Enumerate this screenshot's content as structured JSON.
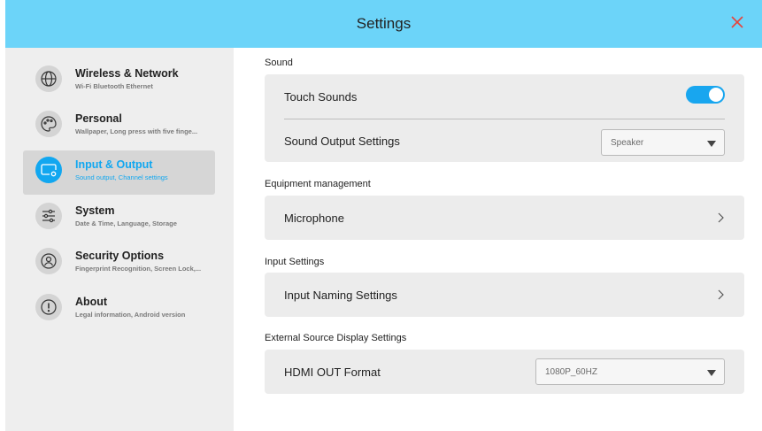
{
  "window": {
    "title": "Settings"
  },
  "sidebar": {
    "items": [
      {
        "label": "Wireless & Network",
        "subtitle": "Wi-Fi Bluetooth Ethernet",
        "icon": "globe-icon"
      },
      {
        "label": "Personal",
        "subtitle": "Wallpaper, Long press with five finge...",
        "icon": "palette-icon"
      },
      {
        "label": "Input & Output",
        "subtitle": "Sound output, Channel settings",
        "icon": "monitor-gear-icon",
        "active": true
      },
      {
        "label": "System",
        "subtitle": "Date & Time, Language, Storage",
        "icon": "sliders-icon"
      },
      {
        "label": "Security Options",
        "subtitle": "Fingerprint Recognition, Screen Lock,...",
        "icon": "user-shield-icon"
      },
      {
        "label": "About",
        "subtitle": "Legal information, Android version",
        "icon": "info-icon"
      }
    ]
  },
  "sections": {
    "sound": {
      "title": "Sound",
      "touch_sounds": {
        "label": "Touch Sounds",
        "enabled": true
      },
      "output": {
        "label": "Sound Output Settings",
        "value": "Speaker"
      }
    },
    "equipment": {
      "title": "Equipment management",
      "microphone": {
        "label": "Microphone"
      }
    },
    "input": {
      "title": "Input Settings",
      "naming": {
        "label": "Input Naming Settings"
      }
    },
    "external": {
      "title": "External Source Display Settings",
      "hdmi": {
        "label": "HDMI OUT Format",
        "value": "1080P_60HZ"
      }
    }
  },
  "colors": {
    "titlebar": "#6cd4f9",
    "accent": "#11a7f0",
    "close": "#e8433a",
    "sidebar_bg": "#eeeeee",
    "card_bg": "#ececec"
  }
}
